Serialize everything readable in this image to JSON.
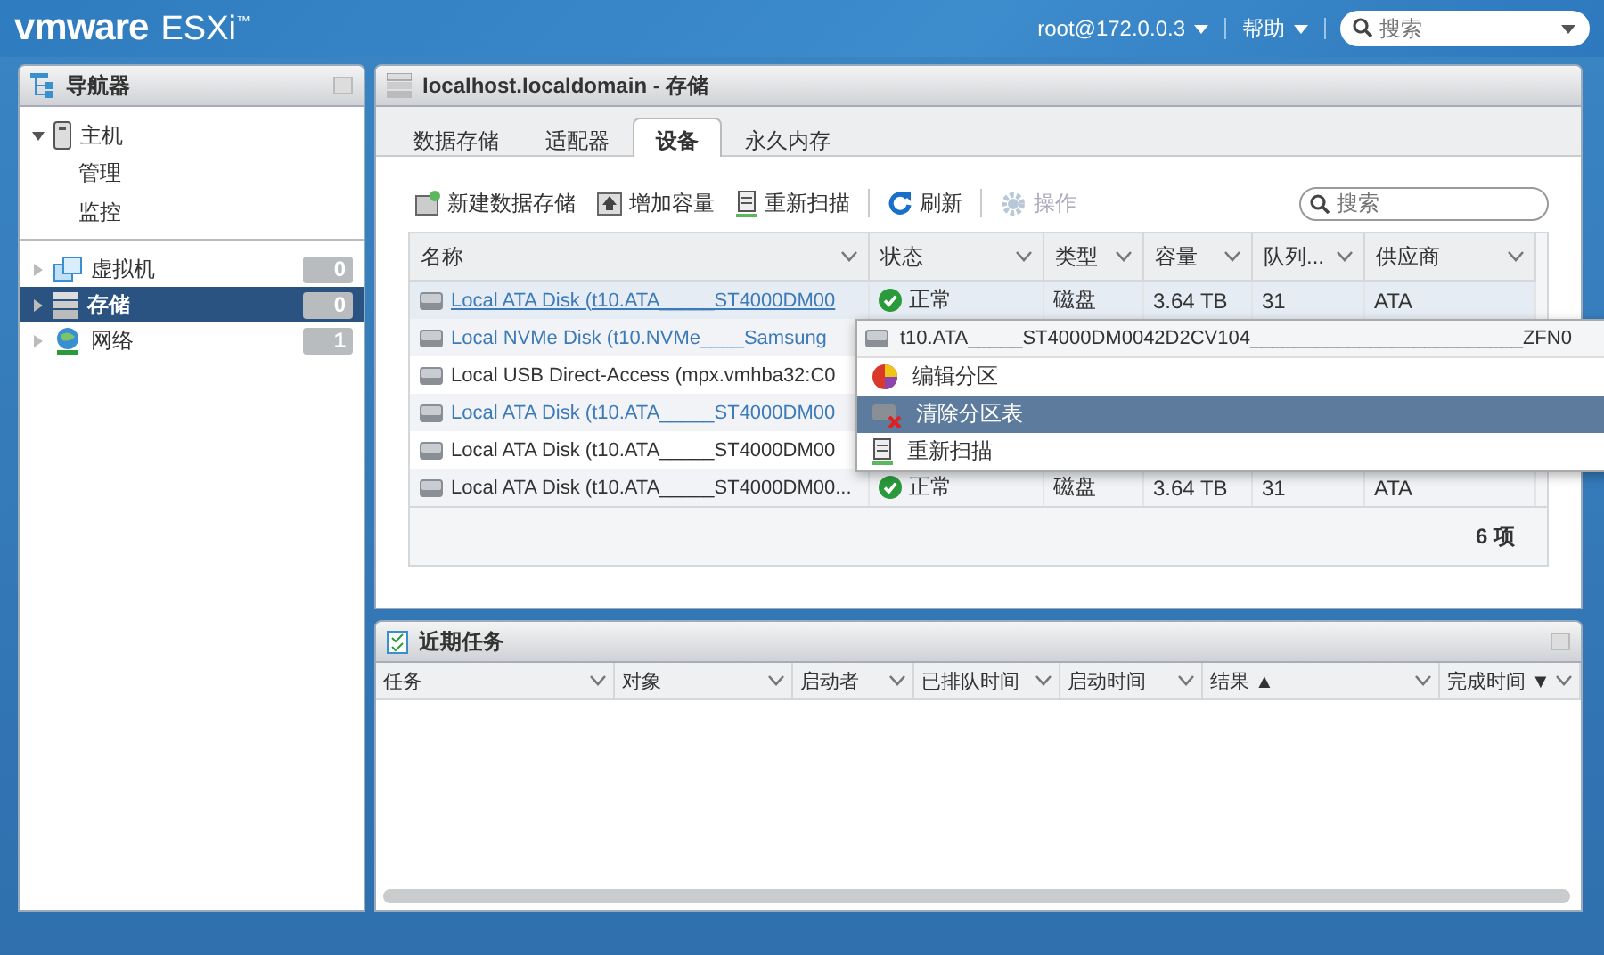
{
  "header": {
    "brand": "vmware",
    "product": "ESXi$^{™}$",
    "user_menu": "root@172.0.0.3",
    "help_menu": "帮助",
    "search": {
      "placeholder": "搜索"
    }
  },
  "navigator": {
    "title": "导航器",
    "items": [
      {
        "kind": "host",
        "label": "主机",
        "expanded": true,
        "selected": false,
        "children": [
          {
            "label": "管理"
          },
          {
            "label": "监控"
          }
        ]
      },
      {
        "kind": "vms",
        "label": "虚拟机",
        "count": "0",
        "expanded": false,
        "selected": false
      },
      {
        "kind": "storage",
        "label": "存储",
        "count": "0",
        "expanded": false,
        "selected": true
      },
      {
        "kind": "network",
        "label": "网络",
        "count": "1",
        "expanded": false,
        "selected": false
      }
    ]
  },
  "main": {
    "title": "localhost.localdomain - 存储",
    "tabs": [
      {
        "label": "数据存储",
        "selected": false
      },
      {
        "label": "适配器",
        "selected": false
      },
      {
        "label": "设备",
        "selected": true
      },
      {
        "label": "永久内存",
        "selected": false
      }
    ],
    "toolbar": [
      {
        "kind": "new",
        "label": "新建数据存储",
        "disabled": false
      },
      {
        "kind": "grow",
        "label": "增加容量",
        "disabled": false
      },
      {
        "kind": "rescan",
        "label": "重新扫描",
        "disabled": false
      },
      {
        "kind": "refresh",
        "label": "刷新",
        "disabled": false
      },
      {
        "kind": "actions",
        "label": "操作",
        "disabled": true
      }
    ],
    "search": {
      "placeholder": "搜索"
    },
    "columns": [
      "名称",
      "状态",
      "类型",
      "容量",
      "队列...",
      "供应商"
    ],
    "rows": [
      {
        "name": "Local ATA Disk (t10.ATA_____ST4000DM00",
        "link": true,
        "selected": true,
        "status": "正常",
        "type": "磁盘",
        "capacity": "3.64 TB",
        "queue": "31",
        "vendor": "ATA"
      },
      {
        "name": "Local NVMe Disk (t10.NVMe____Samsung",
        "link": true,
        "selected": false
      },
      {
        "name": "Local USB Direct-Access (mpx.vmhba32:C0",
        "link": false,
        "selected": false
      },
      {
        "name": "Local ATA Disk (t10.ATA_____ST4000DM00",
        "link": true,
        "selected": false
      },
      {
        "name": "Local ATA Disk (t10.ATA_____ST4000DM00",
        "link": false,
        "selected": false
      },
      {
        "name": "Local ATA Disk (t10.ATA_____ST4000DM00...",
        "link": false,
        "selected": false,
        "status": "正常",
        "type": "磁盘",
        "capacity": "3.64 TB",
        "queue": "31",
        "vendor": "ATA"
      }
    ],
    "footer": "6 项"
  },
  "context_menu": {
    "title": "t10.ATA_____ST4000DM0042D2CV104_________________________ZFN0",
    "items": [
      {
        "kind": "edit",
        "label": "编辑分区",
        "selected": false
      },
      {
        "kind": "clear",
        "label": "清除分区表",
        "selected": true
      },
      {
        "kind": "rescan",
        "label": "重新扫描",
        "selected": false
      }
    ]
  },
  "tasks": {
    "title": "近期任务",
    "columns": [
      "任务",
      "对象",
      "启动者",
      "已排队时间",
      "启动时间",
      "结果 ▲",
      "完成时间 ▼"
    ]
  }
}
